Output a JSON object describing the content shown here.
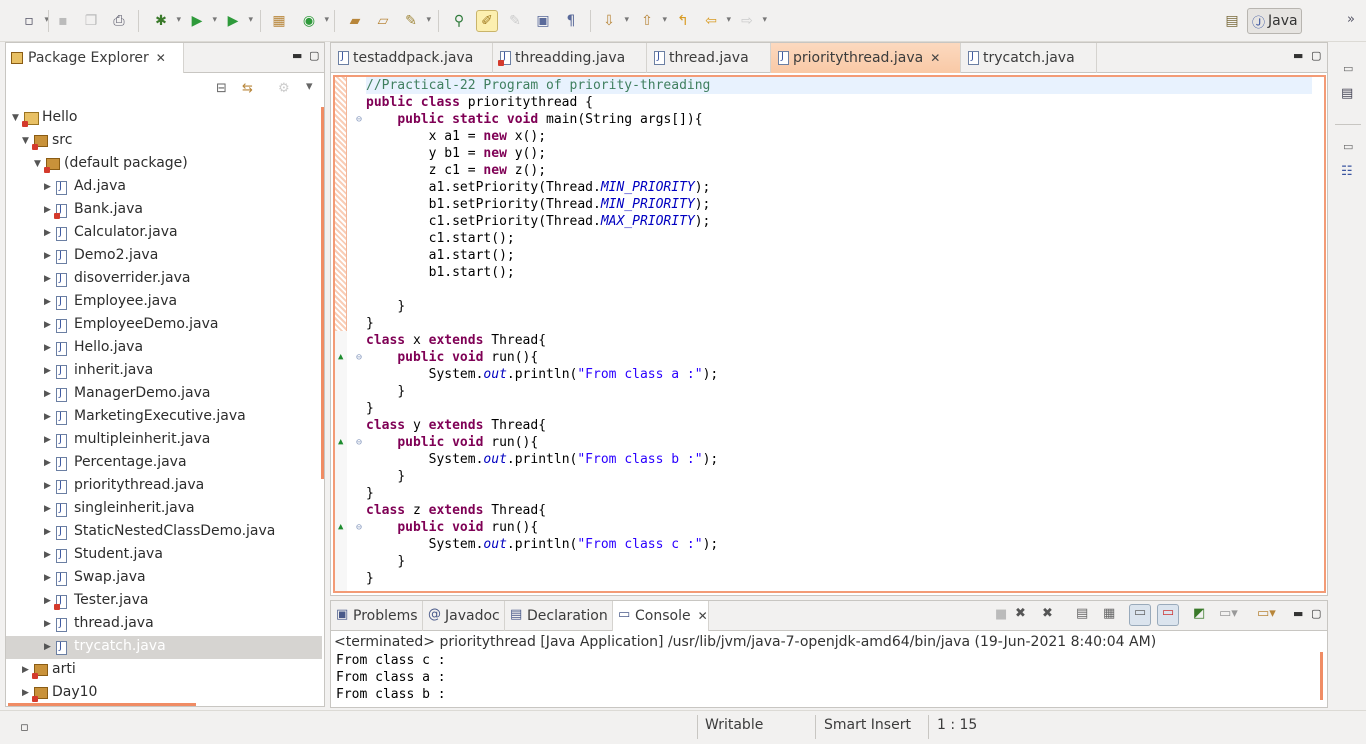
{
  "toolbar": {
    "icons": [
      "new-wizard-icon",
      "save-icon",
      "save-all-icon",
      "print-icon",
      "debug-icon",
      "run-icon",
      "run-external-icon",
      "new-java-project-icon",
      "new-class-icon",
      "open-type-icon",
      "open-task-icon",
      "search-icon",
      "toggle-breakpoint-icon",
      "mark-occurrences-icon",
      "block-selection-icon",
      "show-whitespace-icon",
      "paragraph-icon",
      "next-annotation-icon",
      "prev-annotation-icon",
      "last-edit-icon",
      "back-icon",
      "forward-icon"
    ],
    "perspective_label": "Java"
  },
  "package_explorer": {
    "title": "Package Explorer",
    "tree": [
      {
        "label": "Hello",
        "level": 0,
        "kind": "project",
        "expanded": true
      },
      {
        "label": "src",
        "level": 1,
        "kind": "srcfolder",
        "expanded": true
      },
      {
        "label": "(default package)",
        "level": 2,
        "kind": "package",
        "expanded": true
      },
      {
        "label": "Ad.java",
        "level": 3,
        "kind": "file"
      },
      {
        "label": "Bank.java",
        "level": 3,
        "kind": "file",
        "error": true
      },
      {
        "label": "Calculator.java",
        "level": 3,
        "kind": "file"
      },
      {
        "label": "Demo2.java",
        "level": 3,
        "kind": "file"
      },
      {
        "label": "disoverrider.java",
        "level": 3,
        "kind": "file"
      },
      {
        "label": "Employee.java",
        "level": 3,
        "kind": "file"
      },
      {
        "label": "EmployeeDemo.java",
        "level": 3,
        "kind": "file"
      },
      {
        "label": "Hello.java",
        "level": 3,
        "kind": "file"
      },
      {
        "label": "inherit.java",
        "level": 3,
        "kind": "file"
      },
      {
        "label": "ManagerDemo.java",
        "level": 3,
        "kind": "file"
      },
      {
        "label": "MarketingExecutive.java",
        "level": 3,
        "kind": "file"
      },
      {
        "label": "multipleinherit.java",
        "level": 3,
        "kind": "file"
      },
      {
        "label": "Percentage.java",
        "level": 3,
        "kind": "file"
      },
      {
        "label": "prioritythread.java",
        "level": 3,
        "kind": "file"
      },
      {
        "label": "singleinherit.java",
        "level": 3,
        "kind": "file"
      },
      {
        "label": "StaticNestedClassDemo.java",
        "level": 3,
        "kind": "file"
      },
      {
        "label": "Student.java",
        "level": 3,
        "kind": "file"
      },
      {
        "label": "Swap.java",
        "level": 3,
        "kind": "file"
      },
      {
        "label": "Tester.java",
        "level": 3,
        "kind": "file",
        "error": true
      },
      {
        "label": "thread.java",
        "level": 3,
        "kind": "file"
      },
      {
        "label": "trycatch.java",
        "level": 3,
        "kind": "file",
        "selected": true
      },
      {
        "label": "arti",
        "level": 1,
        "kind": "package"
      },
      {
        "label": "Day10",
        "level": 1,
        "kind": "package"
      }
    ]
  },
  "editor": {
    "tabs": [
      {
        "label": "testaddpack.java",
        "active": false
      },
      {
        "label": "threadding.java",
        "active": false,
        "error": true
      },
      {
        "label": "thread.java",
        "active": false
      },
      {
        "label": "prioritythread.java",
        "active": true
      },
      {
        "label": "trycatch.java",
        "active": false
      }
    ],
    "code": {
      "l1": "//Practical-22 Program of priority-threading",
      "kw_public": "public",
      "kw_class": "class",
      "kw_static": "static",
      "kw_void": "void",
      "kw_new": "new",
      "kw_extends": "extends",
      "class_prioritythread": " prioritythread {",
      "main_sig": " main(String args[]){",
      "x_decl": "x a1 = ",
      "x_ctor": " x();",
      "y_decl": "y b1 = ",
      "y_ctor": " y();",
      "z_decl": "z c1 = ",
      "z_ctor": " z();",
      "a1_set": "a1.setPriority(Thread.",
      "b1_set": "b1.setPriority(Thread.",
      "c1_set": "c1.setPriority(Thread.",
      "min_priority": "MIN_PRIORITY",
      "max_priority": "MAX_PRIORITY",
      "close_paren": ");",
      "c1_start": "c1.start();",
      "a1_start": "a1.start();",
      "b1_start": "b1.start();",
      "brace_close": "}",
      "cls_x": " x ",
      "cls_y": " y ",
      "cls_z": " z ",
      "thread_open": " Thread{",
      "run_sig": " run(){",
      "sysout_pre": "System.",
      "out": "out",
      "println_open": ".println(",
      "str_a": "\"From class a :\"",
      "str_b": "\"From class b :\"",
      "str_c": "\"From class c :\""
    }
  },
  "console_view": {
    "tabs": [
      {
        "label": "Problems",
        "active": false
      },
      {
        "label": "Javadoc",
        "active": false
      },
      {
        "label": "Declaration",
        "active": false
      },
      {
        "label": "Console",
        "active": true
      }
    ],
    "header": "<terminated> prioritythread [Java Application] /usr/lib/jvm/java-7-openjdk-amd64/bin/java (19-Jun-2021 8:40:04 AM)",
    "output": [
      "From class c :",
      "From class a :",
      "From class b :"
    ]
  },
  "status_bar": {
    "writable": "Writable",
    "insert_mode": "Smart Insert",
    "position": "1 : 15"
  }
}
